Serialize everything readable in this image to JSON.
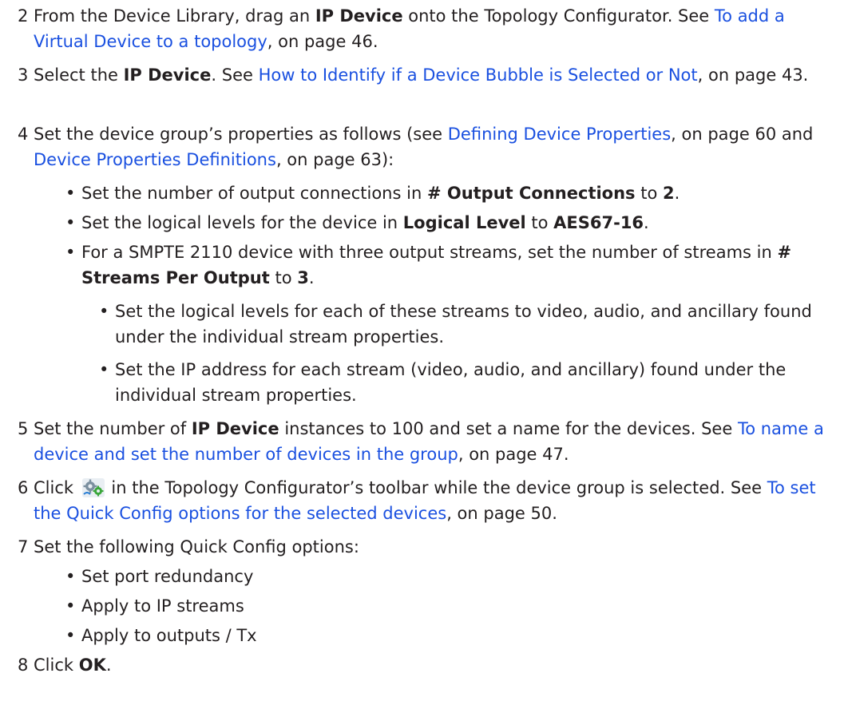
{
  "steps": [
    {
      "number": "2",
      "p1": "From the Device Library, drag an ",
      "b1": "IP Device",
      "p2": " onto the Topology Configurator. See ",
      "link": "To add a Virtual Device to a topology",
      "p3": ", on page 46."
    },
    {
      "number": "3",
      "p1": "Select the ",
      "b1": "IP Device",
      "p2": ". See ",
      "link": "How to Identify if a Device Bubble is Selected or Not",
      "p3": ", on page 43."
    },
    {
      "number": "4",
      "p1": "Set the device group’s properties as follows (see ",
      "link1": "Defining Device Properties",
      "p2": ", on page 60 and ",
      "link2": "Device Properties Definitions",
      "p3": ", on page 63):",
      "bullets": [
        {
          "p1": "Set the number of output connections in ",
          "b1": "# Output Connections",
          "p2": " to ",
          "b2": "2",
          "p3": "."
        },
        {
          "p1": "Set the logical levels for the device in ",
          "b1": "Logical Level",
          "p2": " to ",
          "b2": "AES67-16",
          "p3": "."
        },
        {
          "p1": "For a SMPTE 2110 device with three output streams, set the number of streams in ",
          "b1": "# Streams Per Output",
          "p2": " to ",
          "b2": "3",
          "p3": "."
        }
      ],
      "subbullets": [
        "Set the logical levels for each of these streams to video, audio, and ancillary found under the individual stream properties.",
        "Set the IP address for each stream (video, audio, and ancillary) found under the individual stream properties."
      ]
    },
    {
      "number": "5",
      "p1": "Set the number of ",
      "b1": "IP Device",
      "p2": " instances to 100 and set a name for the devices. See ",
      "link": "To name a device and set the number of devices in the group",
      "p3": ", on page 47."
    },
    {
      "number": "6",
      "p1": "Click ",
      "icon": "quick-config-gears-icon",
      "p2": " in the Topology Configurator’s toolbar while the device group is selected. See ",
      "link": "To set the Quick Config options for the selected devices",
      "p3": ", on page 50."
    },
    {
      "number": "7",
      "p1": "Set the following Quick Config options:",
      "bullets": [
        "Set port redundancy",
        "Apply to IP streams",
        "Apply to outputs / Tx"
      ]
    },
    {
      "number": "8",
      "p1": "Click ",
      "b1": "OK",
      "p2": "."
    }
  ],
  "bullet_char": "•",
  "colors": {
    "text": "#231f20",
    "link": "#1a50e0"
  }
}
